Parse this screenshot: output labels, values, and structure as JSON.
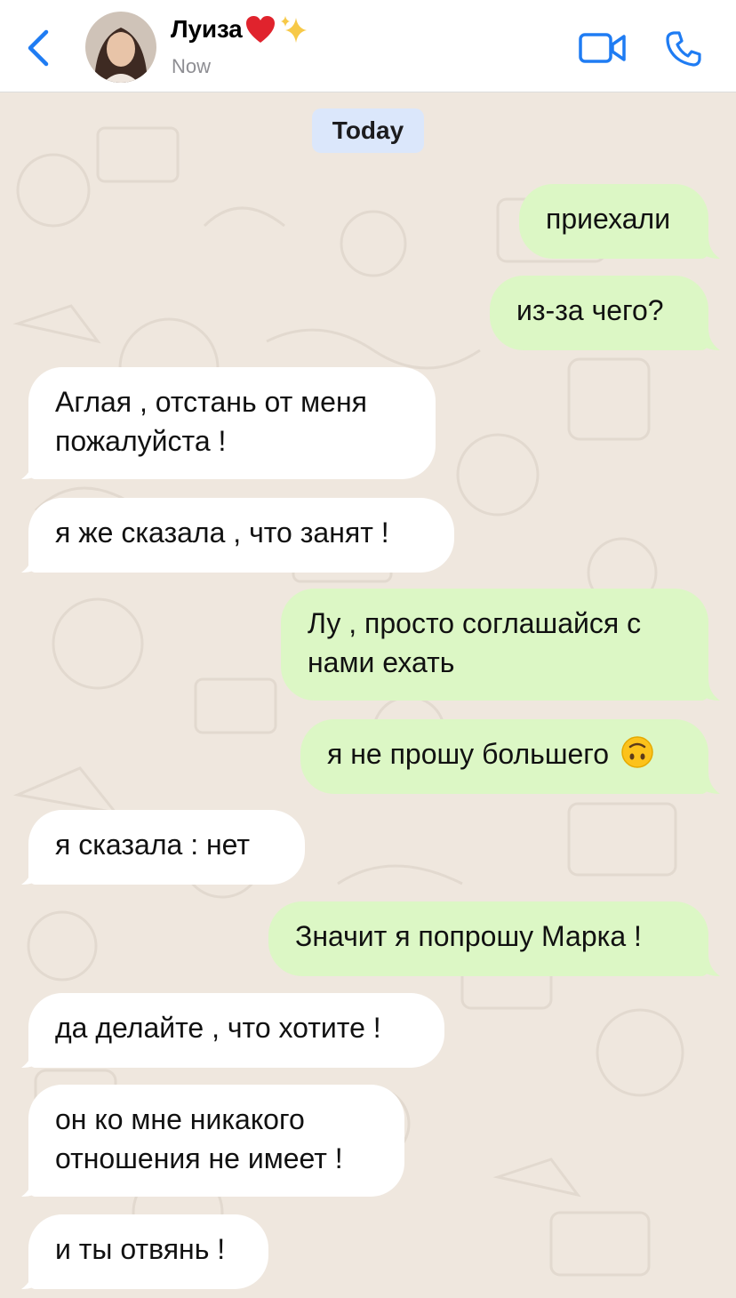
{
  "header": {
    "contact_name": "Луиза",
    "status": "Now",
    "back_icon": "chevron-left-icon",
    "video_icon": "video-camera-icon",
    "phone_icon": "phone-icon",
    "accent_color": "#1f7cf3"
  },
  "chat": {
    "date_label": "Today",
    "messages": [
      {
        "direction": "out",
        "text": "приехали"
      },
      {
        "direction": "out",
        "text": "из-за чего?"
      },
      {
        "direction": "in",
        "line1": "Аглая , отстань от меня",
        "line2": "пожалуйста !"
      },
      {
        "direction": "in",
        "text": "я же сказала , что занят !"
      },
      {
        "direction": "out",
        "line1": "Лу , просто соглашайся с",
        "line2": "нами ехать"
      },
      {
        "direction": "out",
        "text": "я не прошу большего",
        "emoji": "upside-down-face-icon"
      },
      {
        "direction": "in",
        "text": "я сказала : нет"
      },
      {
        "direction": "out",
        "text": "Значит я попрошу Марка !"
      },
      {
        "direction": "in",
        "text": "да делайте , что хотите !"
      },
      {
        "direction": "in",
        "line1": "он ко мне никакого",
        "line2": "отношения не имеет !"
      },
      {
        "direction": "in",
        "text": "и ты отвянь !"
      }
    ]
  },
  "colors": {
    "outgoing_bubble": "#dcf7c5",
    "incoming_bubble": "#ffffff",
    "background": "#efe7de",
    "date_badge": "#dbe7fb"
  }
}
